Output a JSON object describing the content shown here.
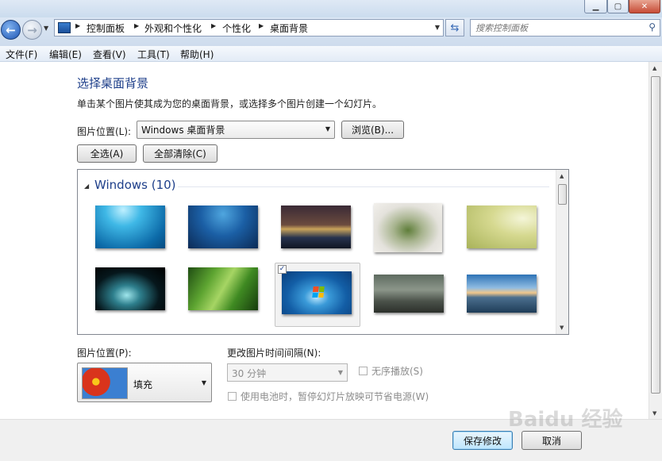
{
  "window": {
    "minimize_glyph": "▁",
    "maximize_glyph": "▢",
    "close_glyph": "✕"
  },
  "nav": {
    "back_icon": "arrow-left",
    "forward_icon": "arrow-right"
  },
  "breadcrumb": [
    "控制面板",
    "外观和个性化",
    "个性化",
    "桌面背景"
  ],
  "search": {
    "placeholder": "搜索控制面板"
  },
  "menu": [
    {
      "label": "文件(F)"
    },
    {
      "label": "编辑(E)"
    },
    {
      "label": "查看(V)"
    },
    {
      "label": "工具(T)"
    },
    {
      "label": "帮助(H)"
    }
  ],
  "main": {
    "title": "选择桌面背景",
    "description": "单击某个图片使其成为您的桌面背景，或选择多个图片创建一个幻灯片。",
    "location_label": "图片位置(L):",
    "location_value": "Windows 桌面背景",
    "browse_label": "浏览(B)...",
    "select_all_label": "全选(A)",
    "clear_all_label": "全部清除(C)"
  },
  "gallery": {
    "group_title": "Windows (10)",
    "selected_index": 7,
    "items": [
      {
        "name": "wallpaper-1",
        "selected": false
      },
      {
        "name": "wallpaper-2",
        "selected": false
      },
      {
        "name": "wallpaper-3",
        "selected": false
      },
      {
        "name": "wallpaper-4",
        "selected": false
      },
      {
        "name": "wallpaper-5",
        "selected": false
      },
      {
        "name": "wallpaper-6",
        "selected": false
      },
      {
        "name": "wallpaper-7",
        "selected": false
      },
      {
        "name": "wallpaper-8",
        "selected": true
      },
      {
        "name": "wallpaper-9",
        "selected": false
      },
      {
        "name": "wallpaper-10",
        "selected": false
      }
    ]
  },
  "options": {
    "position_label": "图片位置(P):",
    "position_value": "填充",
    "interval_label": "更改图片时间间隔(N):",
    "interval_value": "30 分钟",
    "shuffle_label": "无序播放(S)",
    "battery_label": "使用电池时，暂停幻灯片放映可节省电源(W)"
  },
  "footer": {
    "save_label": "保存修改",
    "cancel_label": "取消"
  },
  "watermark": "Baidu 经验",
  "colors": {
    "accent": "#1e3f8a",
    "default_button": "#3c7fb1"
  }
}
